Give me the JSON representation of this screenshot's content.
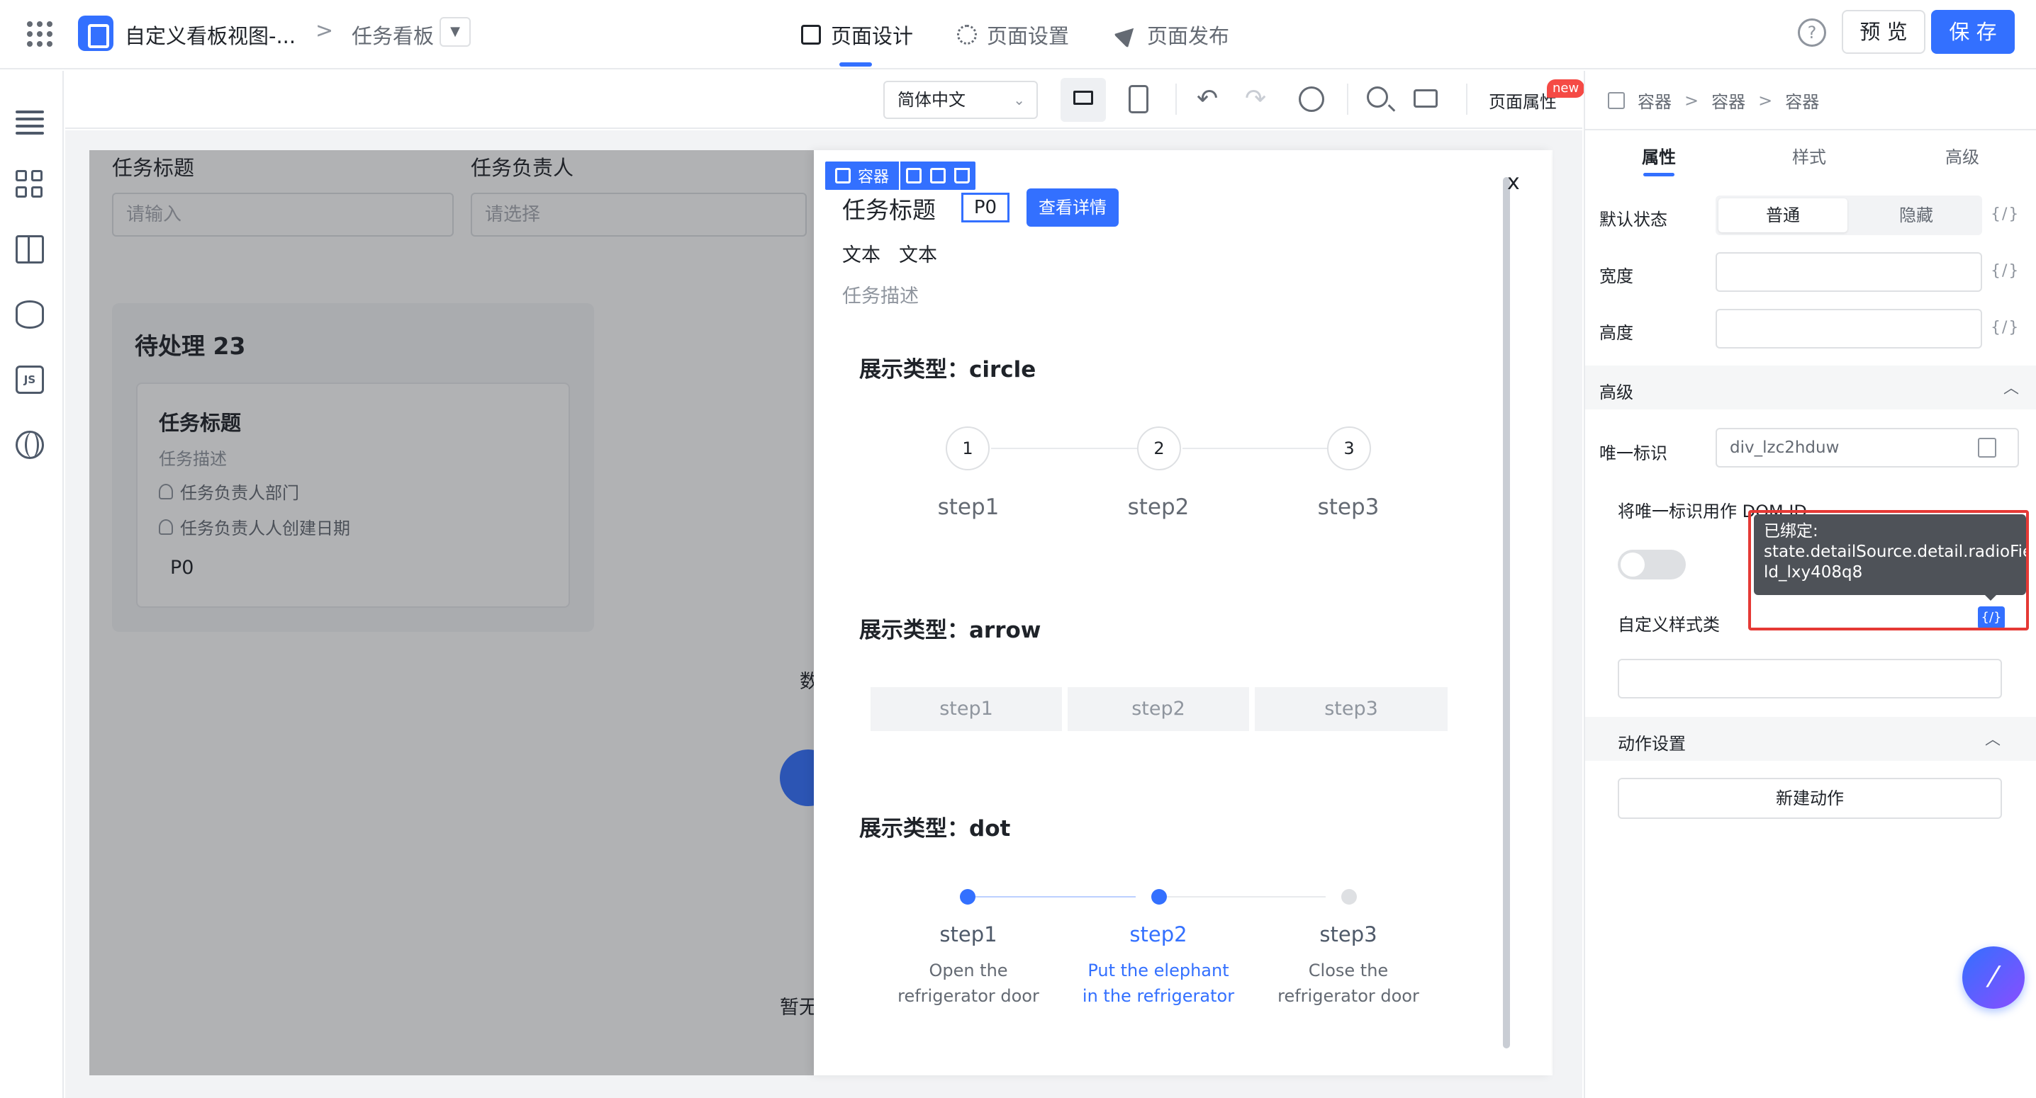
{
  "topbar": {
    "app_title": "自定义看板视图-...",
    "breadcrumb_sep": ">",
    "board_title": "任务看板",
    "nav": {
      "design": "页面设计",
      "settings": "页面设置",
      "publish": "页面发布"
    },
    "help": "?",
    "preview": "预 览",
    "save": "保 存"
  },
  "toolbar": {
    "language": "简体中文",
    "page_props": "页面属性",
    "new_badge": "new"
  },
  "canvas": {
    "filter_title_label": "任务标题",
    "filter_title_placeholder": "请输入",
    "filter_owner_label": "任务负责人",
    "filter_owner_placeholder": "请选择",
    "column_title": "待处理 23",
    "card": {
      "title": "任务标题",
      "desc": "任务描述",
      "owner_dept": "任务负责人部门",
      "owner_date": "任务负责人人创建日期",
      "priority": "P0"
    },
    "data_text": "数",
    "empty_text": "暂无"
  },
  "drawer": {
    "selection_label": "容器",
    "title": "任务标题",
    "priority": "P0",
    "detail_button": "查看详情",
    "text1": "文本",
    "text2": "文本",
    "desc": "任务描述",
    "close": "x",
    "steps_circle": {
      "heading": "展示类型：circle",
      "steps": [
        {
          "num": "1",
          "label": "step1"
        },
        {
          "num": "2",
          "label": "step2"
        },
        {
          "num": "3",
          "label": "step3"
        }
      ]
    },
    "steps_arrow": {
      "heading": "展示类型：arrow",
      "steps": [
        "step1",
        "step2",
        "step3"
      ]
    },
    "steps_dot": {
      "heading": "展示类型：dot",
      "current": 1,
      "steps": [
        {
          "title": "step1",
          "desc_l1": "Open the",
          "desc_l2": "refrigerator door"
        },
        {
          "title": "step2",
          "desc_l1": "Put the elephant",
          "desc_l2": "in the refrigerator"
        },
        {
          "title": "step3",
          "desc_l1": "Close the",
          "desc_l2": "refrigerator door"
        }
      ]
    }
  },
  "rpanel": {
    "breadcrumb": [
      "容器",
      "容器",
      "容器"
    ],
    "tabs": {
      "props": "属性",
      "style": "样式",
      "advanced": "高级"
    },
    "default_state_label": "默认状态",
    "state_normal": "普通",
    "state_hidden": "隐藏",
    "bind_icon": "{/}",
    "width_label": "宽度",
    "height_label": "高度",
    "advanced_section": "高级",
    "uid_label": "唯一标识",
    "uid_value": "div_lzc2hduw",
    "dom_id_label": "将唯一标识用作 DOM ID",
    "tooltip_l1": "已绑定:",
    "tooltip_l2": "state.detailSource.detail.radioFie",
    "tooltip_l3": "ld_lxy408q8",
    "custom_class_label": "自定义样式类",
    "action_section": "动作设置",
    "new_action": "新建动作"
  },
  "colors": {
    "accent": "#3370ff",
    "highlight": "#e53935",
    "badge": "#f54a45"
  }
}
